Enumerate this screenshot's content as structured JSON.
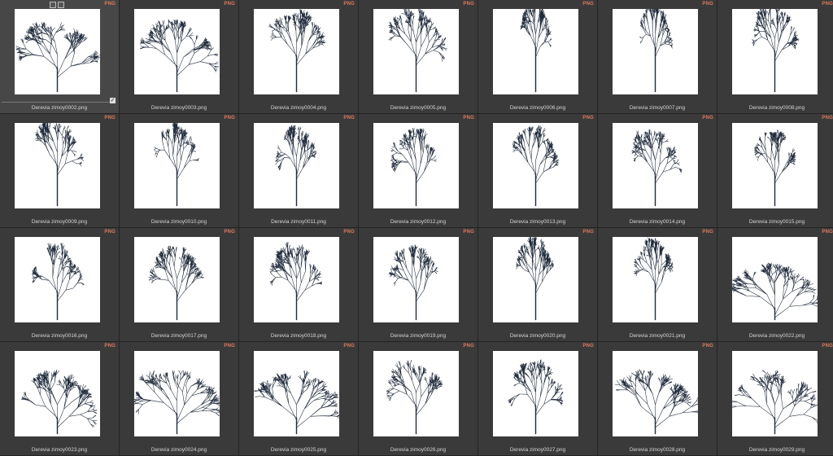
{
  "browser": {
    "badge_label": "PNG",
    "selected_index": 0,
    "colors": {
      "background": "#2b2b2b",
      "cell": "#3a3a3a",
      "thumb": "#ffffff",
      "badge": "#e07a5f",
      "tree": "#1f2a3b"
    },
    "thumbnails": [
      {
        "filename": "Derevia zimoy0002.png"
      },
      {
        "filename": "Derevia zimoy0003.png"
      },
      {
        "filename": "Derevia zimoy0004.png"
      },
      {
        "filename": "Derevia zimoy0005.png"
      },
      {
        "filename": "Derevia zimoy0006.png"
      },
      {
        "filename": "Derevia zimoy0007.png"
      },
      {
        "filename": "Derevia zimoy0008.png"
      },
      {
        "filename": "Derevia zimoy0009.png"
      },
      {
        "filename": "Derevia zimoy0010.png"
      },
      {
        "filename": "Derevia zimoy0011.png"
      },
      {
        "filename": "Derevia zimoy0012.png"
      },
      {
        "filename": "Derevia zimoy0013.png"
      },
      {
        "filename": "Derevia zimoy0014.png"
      },
      {
        "filename": "Derevia zimoy0015.png"
      },
      {
        "filename": "Derevia zimoy0016.png"
      },
      {
        "filename": "Derevia zimoy0017.png"
      },
      {
        "filename": "Derevia zimoy0018.png"
      },
      {
        "filename": "Derevia zimoy0019.png"
      },
      {
        "filename": "Derevia zimoy0020.png"
      },
      {
        "filename": "Derevia zimoy0021.png"
      },
      {
        "filename": "Derevia zimoy0022.png"
      },
      {
        "filename": "Derevia zimoy0023.png"
      },
      {
        "filename": "Derevia zimoy0024.png"
      },
      {
        "filename": "Derevia zimoy0025.png"
      },
      {
        "filename": "Derevia zimoy0026.png"
      },
      {
        "filename": "Derevia zimoy0027.png"
      },
      {
        "filename": "Derevia zimoy0028.png"
      },
      {
        "filename": "Derevia zimoy0029.png"
      }
    ]
  }
}
